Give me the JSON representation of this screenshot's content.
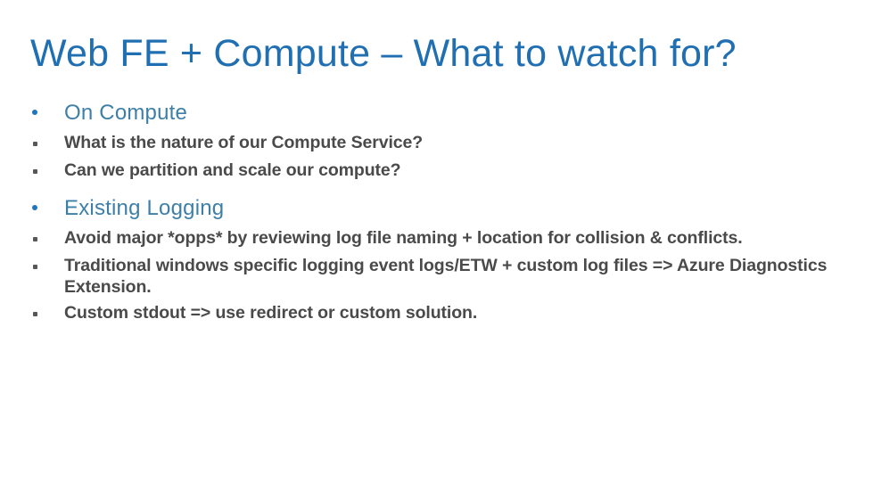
{
  "slide": {
    "title": "Web FE + Compute – What to watch for?",
    "background_color": "#ffffff",
    "title_color": "#1F6FB2",
    "heading_color": "#3E7FA8",
    "body_color": "#4A4A4A",
    "bullet_level1_color": "#1F76BC",
    "bullet_level2_color": "#575757",
    "blocks": [
      {
        "level": 1,
        "marker": "round-bullet",
        "text": "On Compute"
      },
      {
        "level": 2,
        "marker": "square-bullet",
        "text": "What is the nature of our Compute Service?"
      },
      {
        "level": 2,
        "marker": "square-bullet",
        "text": "Can we partition and scale our compute?"
      },
      {
        "level": 1,
        "marker": "round-bullet",
        "text": "Existing Logging"
      },
      {
        "level": 2,
        "marker": "square-bullet",
        "text": "Avoid major *opps* by reviewing log file naming + location for collision & conflicts."
      },
      {
        "level": 2,
        "marker": "square-bullet",
        "text": "Traditional windows specific logging event logs/ETW + custom log files => Azure Diagnostics Extension."
      },
      {
        "level": 2,
        "marker": "square-bullet",
        "text": "Custom stdout => use redirect or custom solution."
      }
    ]
  }
}
